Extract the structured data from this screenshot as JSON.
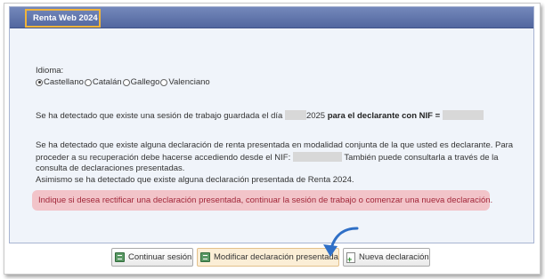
{
  "panel": {
    "title": "Renta Web 2024"
  },
  "language": {
    "label": "Idioma:",
    "options": [
      "Castellano",
      "Catalán",
      "Gallego",
      "Valenciano"
    ],
    "selected": "Castellano"
  },
  "session_notice": {
    "text_before": "Se ha detectado que existe una sesión de trabajo guardada el día",
    "text_year": "2025",
    "text_bold": "para el declarante con NIF ="
  },
  "joint_notice": {
    "line1": "Se ha detectado que existe alguna declaración de renta presentada en modalidad conjunta de la que usted es declarante. Para proceder a su recuperación debe hacerse accediendo desde el NIF:",
    "line1_after": "También puede consultarla a través de la consulta de declaraciones presentadas.",
    "line2": "Asimismo se ha detectado que existe alguna declaración presentada de Renta 2024."
  },
  "alert": {
    "text": "Indique si desea rectificar una declaración presentada, continuar la sesión de trabajo o comenzar una nueva declaración."
  },
  "buttons": {
    "continue": "Continuar sesión",
    "modify": "Modificar declaración presentada",
    "new": "Nueva declaración"
  },
  "colors": {
    "header": "#5f73a9",
    "highlight_border": "#f0b43a",
    "alert_bg": "#f2c4c9",
    "alert_text": "#a2283a",
    "arrow": "#2f6fc6"
  }
}
